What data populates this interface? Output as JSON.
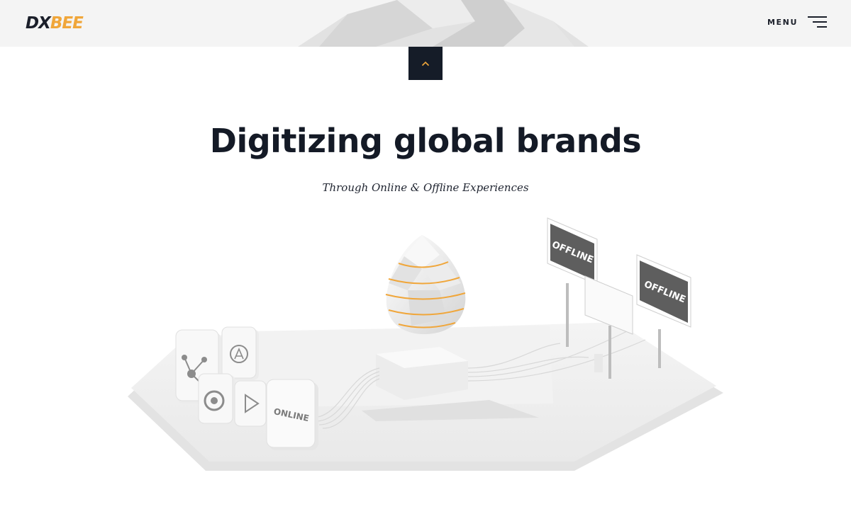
{
  "header": {
    "logo": {
      "part1": "DX",
      "part2": "BEE"
    },
    "menu_label": "MENU"
  },
  "scroll_top": {
    "icon": "chevron-up-icon"
  },
  "hero": {
    "title": "Digitizing global brands",
    "subtitle": "Through Online & Offline Experiences"
  },
  "illustration": {
    "screen_labels": [
      "OFFLINE",
      "OFFLINE"
    ],
    "tile_label": "ONLINE",
    "app_icons": [
      "share-icon",
      "app-store-icon",
      "chrome-icon",
      "play-store-icon"
    ]
  },
  "colors": {
    "accent": "#f0a63a",
    "dark": "#151c28",
    "header_bg": "#f4f4f4",
    "screen": "#5e5e5e"
  }
}
